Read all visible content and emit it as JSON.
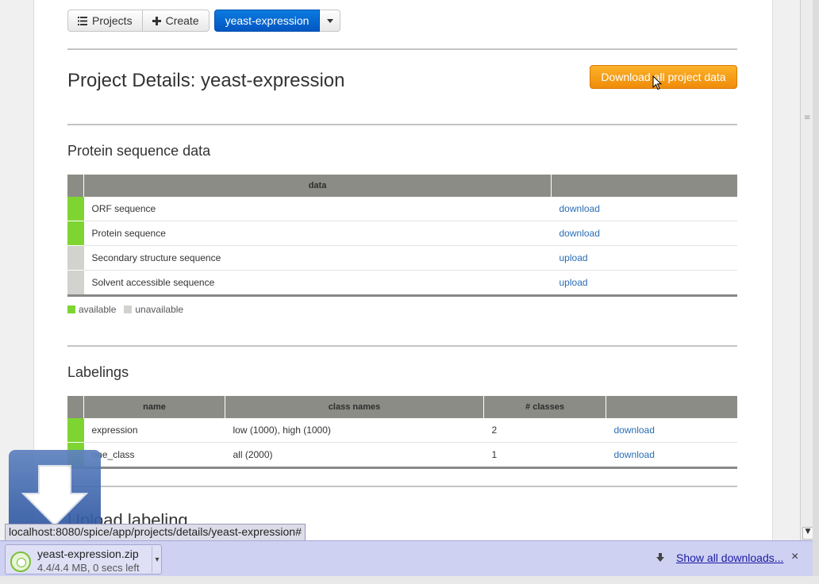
{
  "nav": {
    "projects_label": "Projects",
    "create_label": "Create",
    "current_project": "yeast-expression"
  },
  "page": {
    "title": "Project Details: yeast-expression",
    "download_all_label": "Download all project data"
  },
  "protein": {
    "heading": "Protein sequence data",
    "columns": [
      "data",
      ""
    ],
    "rows": [
      {
        "name": "ORF sequence",
        "action": "download",
        "status": "available"
      },
      {
        "name": "Protein sequence",
        "action": "download",
        "status": "available"
      },
      {
        "name": "Secondary structure sequence",
        "action": "upload",
        "status": "unavailable"
      },
      {
        "name": "Solvent accessible sequence",
        "action": "upload",
        "status": "unavailable"
      }
    ],
    "legend": {
      "available": "available",
      "unavailable": "unavailable"
    }
  },
  "labelings": {
    "heading": "Labelings",
    "columns": [
      "name",
      "class names",
      "# classes",
      ""
    ],
    "rows": [
      {
        "name": "expression",
        "class_names": "low (1000), high (1000)",
        "num_classes": "2",
        "action": "download"
      },
      {
        "name": "one_class",
        "class_names": "all (2000)",
        "num_classes": "1",
        "action": "download"
      }
    ]
  },
  "upload": {
    "heading": "Upload labeling"
  },
  "status_url": "localhost:8080/spice/app/projects/details/yeast-expression#",
  "downloads": {
    "file_name": "yeast-expression.zip",
    "status": "4.4/4.4 MB, 0 secs left",
    "show_all_label": "Show all downloads..."
  },
  "colors": {
    "available": "#7ed532",
    "unavailable": "#d2d2ce",
    "primary": "#0a6fd6",
    "orange": "#f39c12"
  }
}
